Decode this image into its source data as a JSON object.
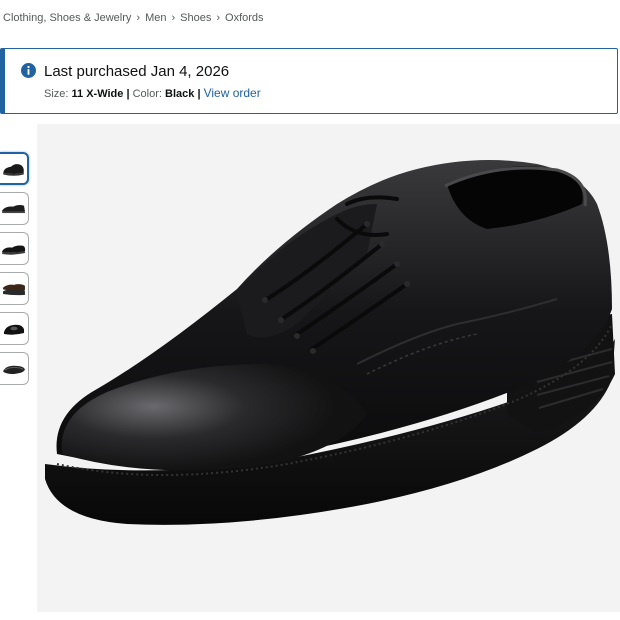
{
  "breadcrumb": {
    "items": [
      "Clothing, Shoes & Jewelry",
      "Men",
      "Shoes",
      "Oxfords"
    ],
    "separator": "›"
  },
  "purchase_alert": {
    "icon": "info-icon",
    "title": "Last purchased Jan 4, 2026",
    "size_label": "Size:",
    "size_value": "11 X-Wide",
    "color_label": "Color:",
    "color_value": "Black",
    "divider": "|",
    "link": "View order",
    "accent_color": "#2162a1"
  },
  "gallery": {
    "thumbnail_count": 6,
    "selected_index": 0
  }
}
